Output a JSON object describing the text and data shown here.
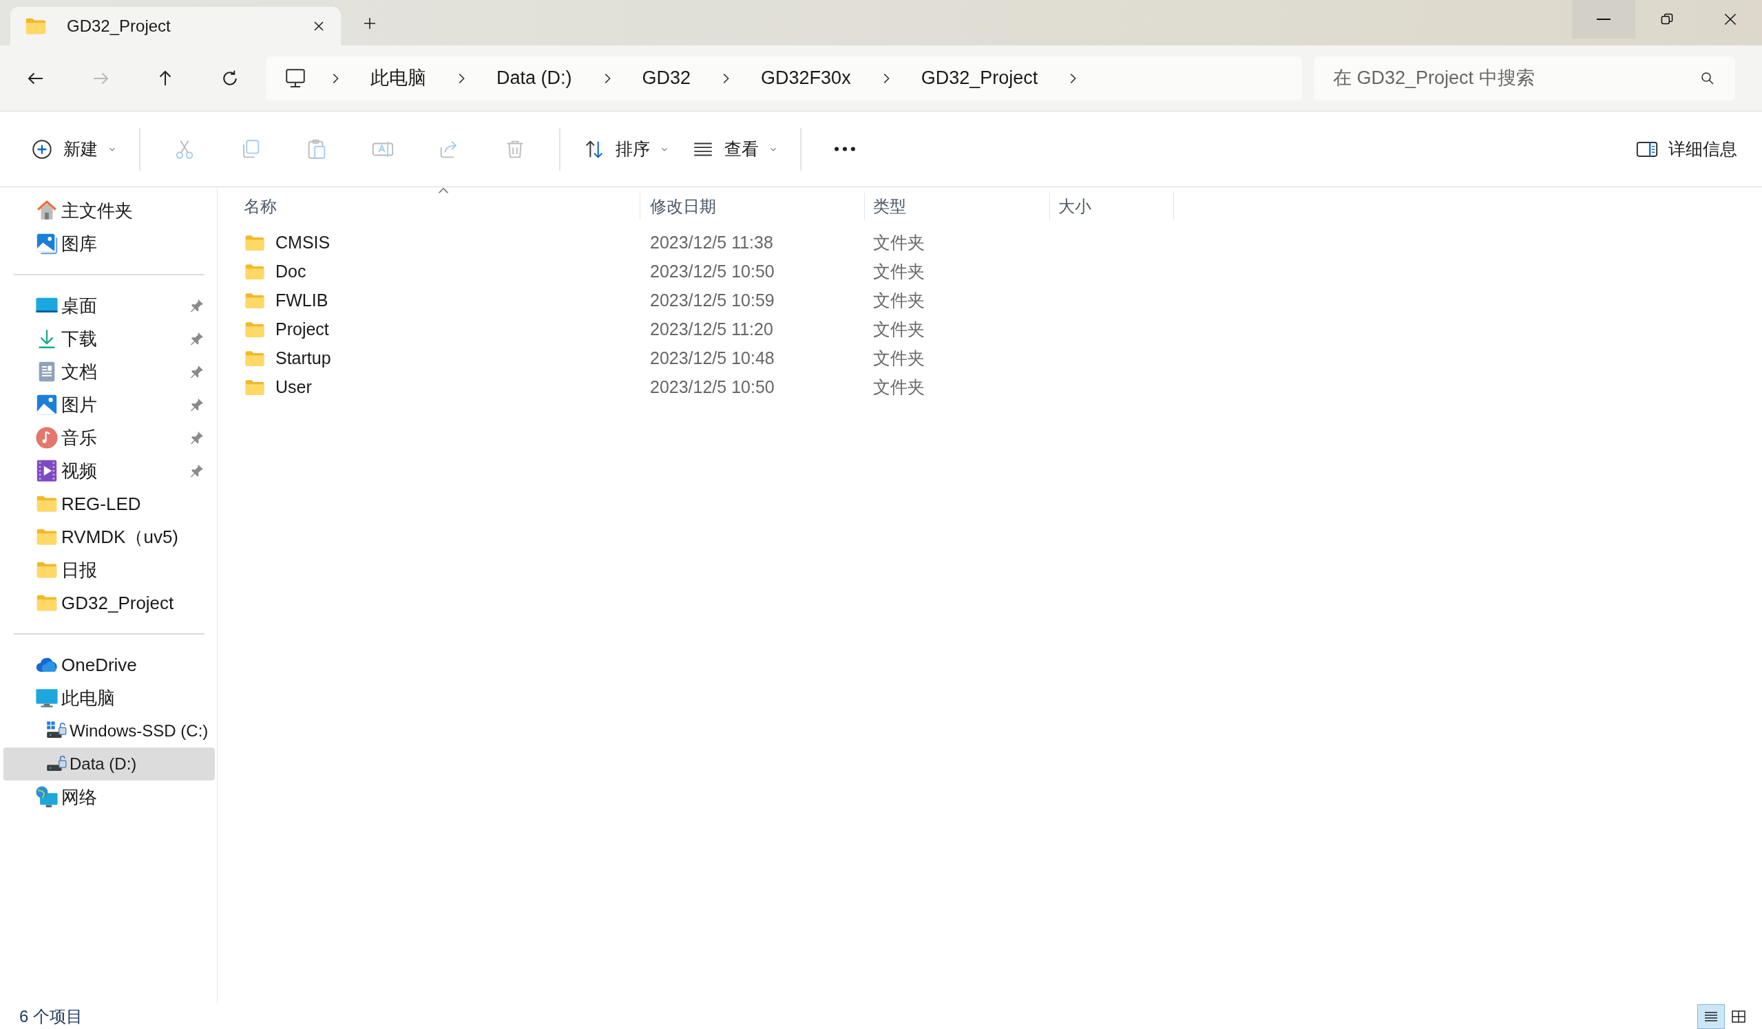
{
  "window": {
    "tab_title": "GD32_Project"
  },
  "nav_buttons": [
    {
      "kind": "back",
      "disabled": false
    },
    {
      "kind": "forward",
      "disabled": true
    },
    {
      "kind": "up",
      "disabled": false
    },
    {
      "kind": "refresh",
      "disabled": false
    }
  ],
  "breadcrumb": [
    "此电脑",
    "Data (D:)",
    "GD32",
    "GD32F30x",
    "GD32_Project"
  ],
  "search": {
    "placeholder": "在 GD32_Project 中搜索"
  },
  "toolbar": [
    [
      {
        "kind": "new",
        "label": "新建",
        "dropdown": true,
        "disabled": false
      }
    ],
    [
      {
        "kind": "cut",
        "disabled": true
      },
      {
        "kind": "copy",
        "disabled": true
      },
      {
        "kind": "paste",
        "disabled": true
      },
      {
        "kind": "rename",
        "disabled": true
      },
      {
        "kind": "share",
        "disabled": true
      },
      {
        "kind": "delete",
        "disabled": true
      }
    ],
    [
      {
        "kind": "sort",
        "label": "排序",
        "dropdown": true,
        "disabled": false
      },
      {
        "kind": "view",
        "label": "查看",
        "dropdown": true,
        "disabled": false
      }
    ],
    [
      {
        "kind": "more",
        "disabled": false
      }
    ]
  ],
  "details_button": {
    "label": "详细信息"
  },
  "sidebar": [
    [
      {
        "label": "主文件夹",
        "kind": "home",
        "pinned": false,
        "selected": false
      },
      {
        "label": "图库",
        "kind": "gallery",
        "pinned": false,
        "selected": false
      }
    ],
    [
      {
        "label": "桌面",
        "kind": "desktop",
        "pinned": true,
        "selected": false
      },
      {
        "label": "下载",
        "kind": "download",
        "pinned": true,
        "selected": false
      },
      {
        "label": "文档",
        "kind": "documents",
        "pinned": true,
        "selected": false
      },
      {
        "label": "图片",
        "kind": "pictures",
        "pinned": true,
        "selected": false
      },
      {
        "label": "音乐",
        "kind": "music",
        "pinned": true,
        "selected": false
      },
      {
        "label": "视频",
        "kind": "videos",
        "pinned": true,
        "selected": false
      },
      {
        "label": "REG-LED",
        "kind": "folder",
        "pinned": false,
        "selected": false
      },
      {
        "label": "RVMDK（uv5)",
        "kind": "folder",
        "pinned": false,
        "selected": false
      },
      {
        "label": "日报",
        "kind": "folder",
        "pinned": false,
        "selected": false
      },
      {
        "label": "GD32_Project",
        "kind": "folder",
        "pinned": false,
        "selected": false
      }
    ],
    [
      {
        "label": "OneDrive",
        "kind": "onedrive",
        "pinned": false,
        "selected": false
      },
      {
        "label": "此电脑",
        "kind": "pc",
        "pinned": false,
        "selected": false,
        "children": [
          {
            "label": "Windows-SSD (C:)",
            "kind": "system-drive",
            "selected": false
          },
          {
            "label": "Data (D:)",
            "kind": "drive",
            "selected": true
          }
        ]
      },
      {
        "label": "网络",
        "kind": "network",
        "pinned": false,
        "selected": false
      }
    ]
  ],
  "table": {
    "columns": [
      "名称",
      "修改日期",
      "类型",
      "大小"
    ],
    "rows": [
      {
        "name": "CMSIS",
        "modified": "2023/12/5 11:38",
        "type": "文件夹"
      },
      {
        "name": "Doc",
        "modified": "2023/12/5 10:50",
        "type": "文件夹"
      },
      {
        "name": "FWLIB",
        "modified": "2023/12/5 10:59",
        "type": "文件夹"
      },
      {
        "name": "Project",
        "modified": "2023/12/5 11:20",
        "type": "文件夹"
      },
      {
        "name": "Startup",
        "modified": "2023/12/5 10:48",
        "type": "文件夹"
      },
      {
        "name": "User",
        "modified": "2023/12/5 10:50",
        "type": "文件夹"
      }
    ]
  },
  "status_bar": {
    "item_count": "6 个项目",
    "views": [
      {
        "kind": "details",
        "selected": true
      },
      {
        "kind": "tiles",
        "selected": false
      }
    ]
  }
}
